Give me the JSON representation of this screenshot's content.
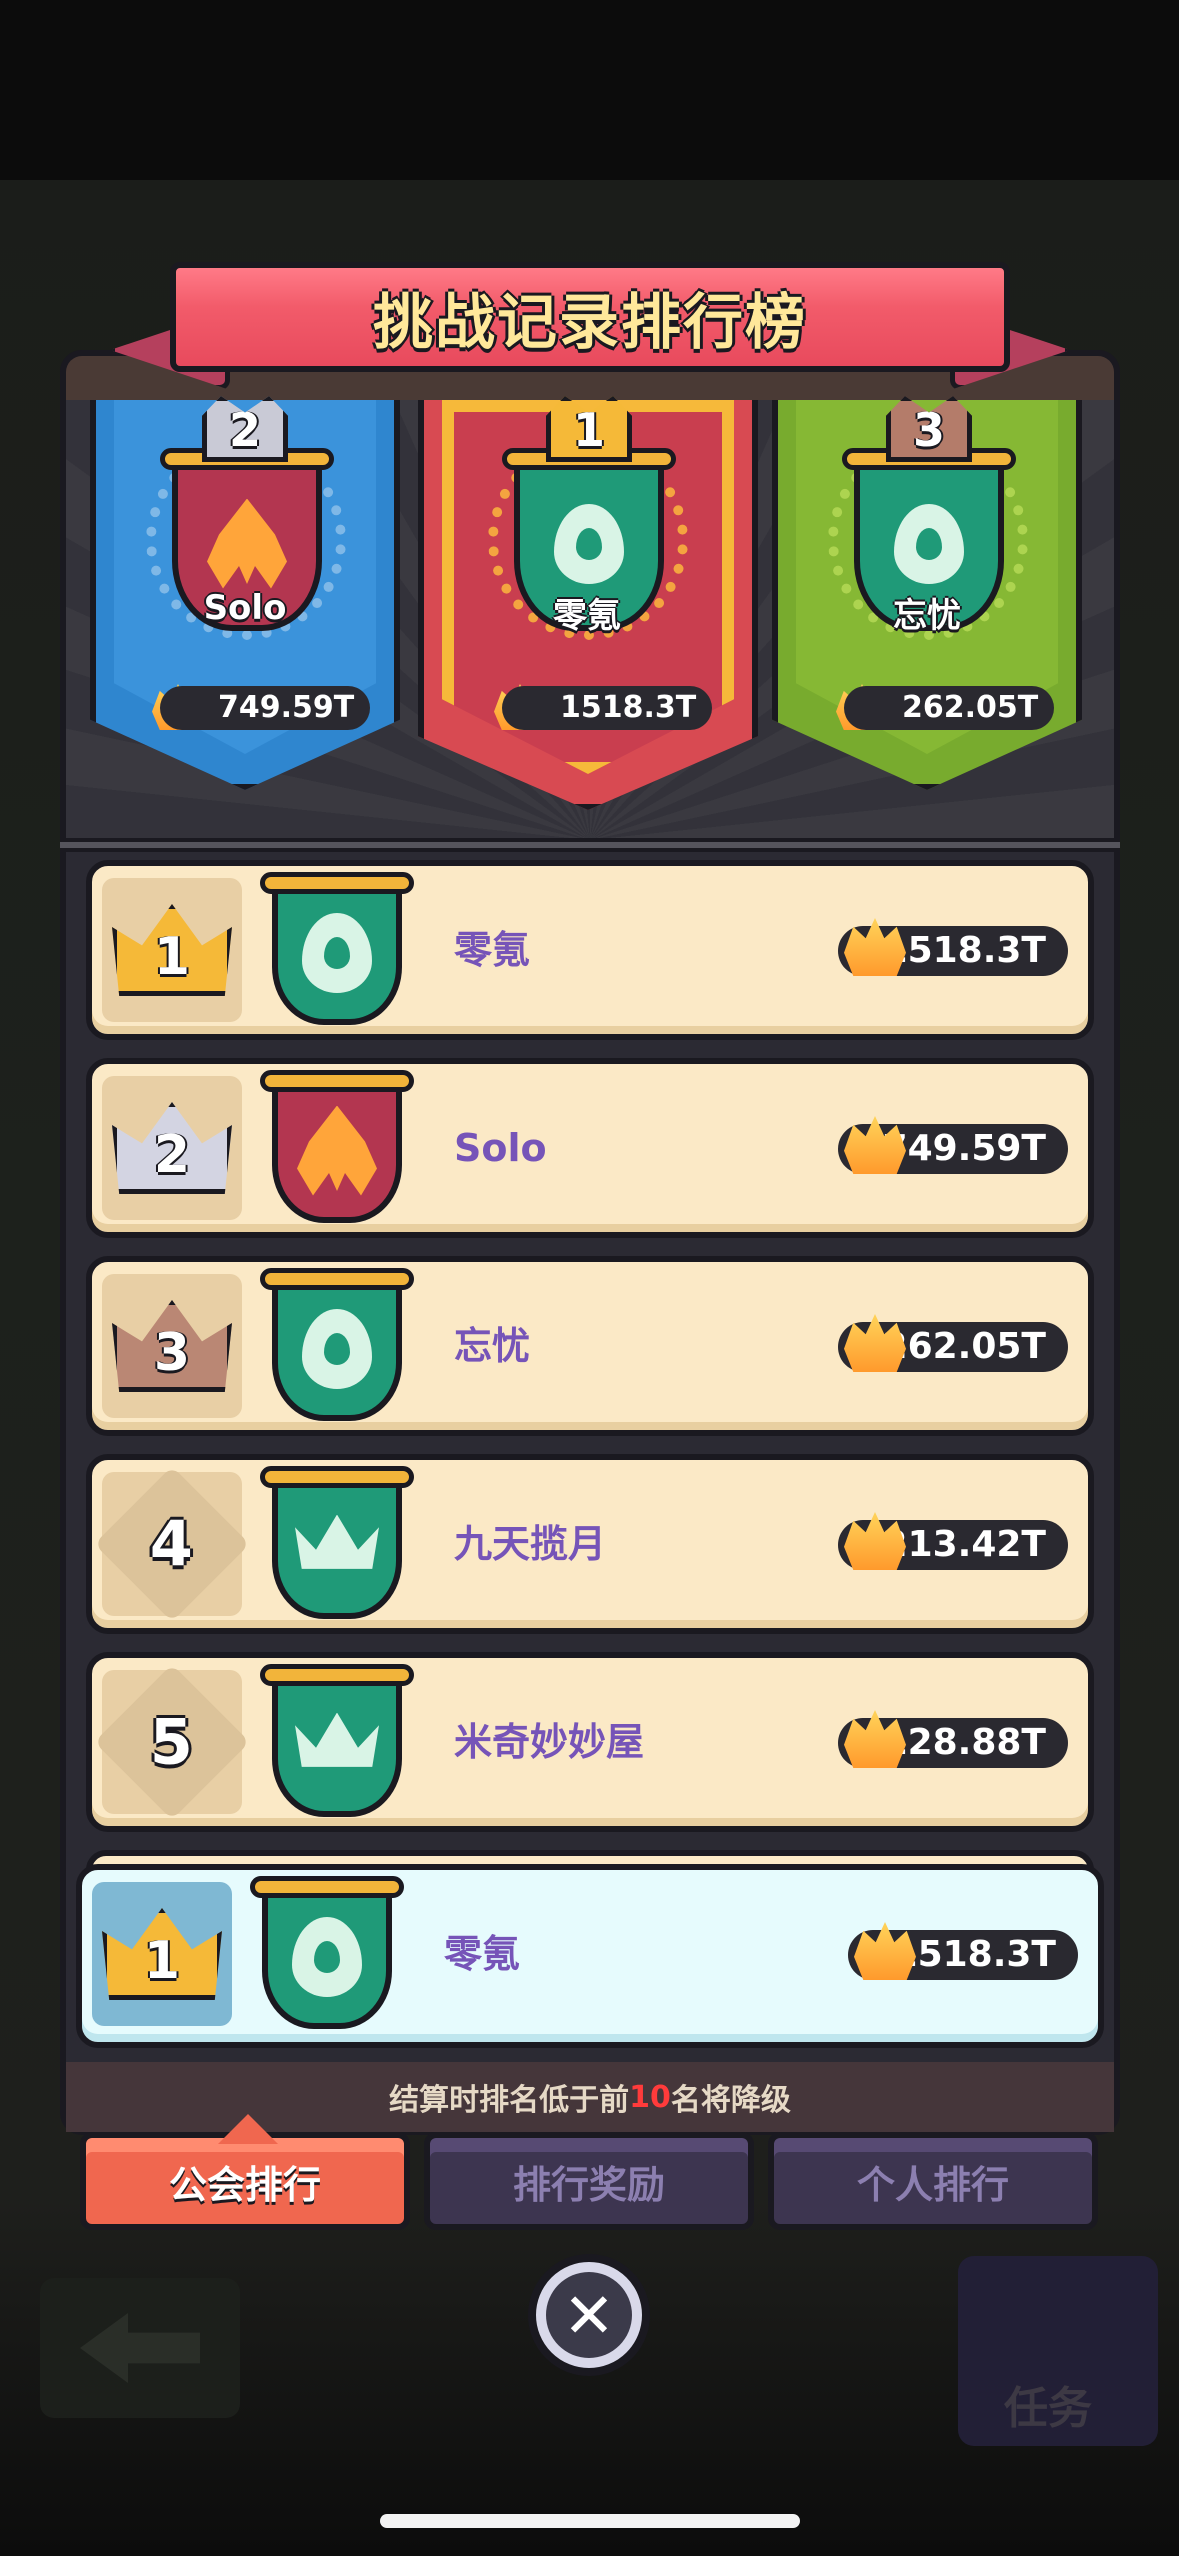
{
  "title": "挑战记录排行榜",
  "podium": [
    {
      "rank": "2",
      "name": "Solo",
      "score": "749.59T",
      "color": "#2f86cf",
      "emblem": "fire-emblem-icon"
    },
    {
      "rank": "1",
      "name": "零氪",
      "score": "1518.3T",
      "color": "#d84a52",
      "emblem": "drop-emblem-icon"
    },
    {
      "rank": "3",
      "name": "忘忧",
      "score": "262.05T",
      "color": "#78ab2e",
      "emblem": "drop-emblem-icon"
    }
  ],
  "rows": [
    {
      "rank": "1",
      "name": "零氪",
      "score": "1518.3T",
      "medal": "gold-crown-icon",
      "emblem": "drop-emblem-icon"
    },
    {
      "rank": "2",
      "name": "Solo",
      "score": "749.59T",
      "medal": "silver-crown-icon",
      "emblem": "fire-emblem-icon"
    },
    {
      "rank": "3",
      "name": "忘忧",
      "score": "262.05T",
      "medal": "bronze-crown-icon",
      "emblem": "drop-emblem-icon"
    },
    {
      "rank": "4",
      "name": "九天揽月",
      "score": "213.42T",
      "medal": "diamond-icon",
      "emblem": "crown-emblem-icon"
    },
    {
      "rank": "5",
      "name": "米奇妙妙屋",
      "score": "128.88T",
      "medal": "diamond-icon",
      "emblem": "crown-emblem-icon"
    }
  ],
  "my_row": {
    "rank": "1",
    "name": "零氪",
    "score": "1518.3T"
  },
  "note": {
    "before": "结算时排名低于前",
    "highlight": "10",
    "after": "名将降级"
  },
  "tabs": [
    {
      "label": "公会排行",
      "active": true
    },
    {
      "label": "排行奖励",
      "active": false
    },
    {
      "label": "个人排行",
      "active": false
    }
  ],
  "task_label": "任务",
  "colors": {
    "accent_tab": "#f0674f",
    "name_purple": "#7654b8",
    "row_bg": "#fbe9c6",
    "my_row_bg": "#e6fbfd"
  }
}
